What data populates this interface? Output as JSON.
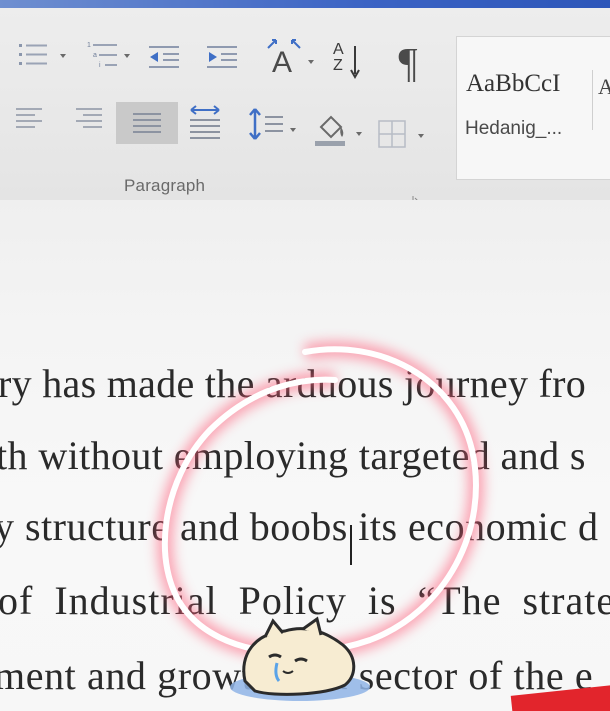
{
  "ribbon": {
    "paragraph_group": {
      "label": "Paragraph",
      "buttons": [
        {
          "icon": "bullets-icon"
        },
        {
          "icon": "numbering-icon"
        },
        {
          "icon": "multilevel-list-icon"
        },
        {
          "icon": "decrease-indent-icon"
        },
        {
          "icon": "increase-indent-icon"
        },
        {
          "icon": "change-case-icon"
        },
        {
          "icon": "sort-icon"
        },
        {
          "icon": "pilcrow-icon"
        },
        {
          "icon": "align-left-icon"
        },
        {
          "icon": "align-right-icon"
        },
        {
          "icon": "justify-icon"
        },
        {
          "icon": "distributed-icon"
        },
        {
          "icon": "line-spacing-icon"
        },
        {
          "icon": "shading-icon"
        },
        {
          "icon": "borders-icon"
        }
      ],
      "sort_glyph": "A\nZ",
      "change_case_glyph": "A",
      "pilcrow_glyph": "¶"
    },
    "styles": {
      "sample": "AaBbCcI",
      "name": "Hedanig_...",
      "next_sample": "A"
    }
  },
  "document": {
    "lines": [
      "ry has made the arduous journey fro",
      "th without employing targeted and s",
      "y structure and boobs its economic d",
      "of Industrial Policy is “The strate",
      "ment and growth of a sector of the e"
    ]
  },
  "overlay": {
    "ring_color": "#ffffff",
    "glow_color": "#ff5c78",
    "sticker": "cat-sticker"
  },
  "colors": {
    "title_bar": "#2d56b9",
    "ribbon_bg": "#e8e8e8",
    "selected_button": "#c8c8c8",
    "doc_text": "#2a2a2a"
  }
}
